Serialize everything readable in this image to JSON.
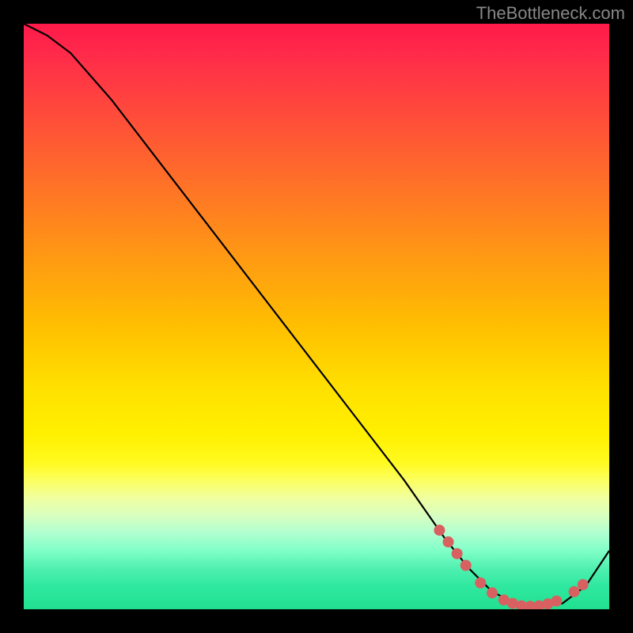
{
  "watermark": "TheBottleneck.com",
  "chart_data": {
    "type": "line",
    "title": "",
    "xlabel": "",
    "ylabel": "",
    "xlim": [
      0,
      100
    ],
    "ylim": [
      0,
      100
    ],
    "series": [
      {
        "name": "bottleneck-curve",
        "x": [
          0,
          4,
          8,
          15,
          25,
          35,
          45,
          55,
          65,
          72,
          76,
          80,
          84,
          88,
          92,
          96,
          100
        ],
        "values": [
          100,
          98,
          95,
          87,
          74,
          61,
          48,
          35,
          22,
          12,
          7,
          3,
          1,
          0.5,
          1,
          4,
          10
        ]
      }
    ],
    "markers": {
      "name": "highlight-points",
      "color": "#d86060",
      "points": [
        {
          "x": 71,
          "y": 13.5
        },
        {
          "x": 72.5,
          "y": 11.5
        },
        {
          "x": 74,
          "y": 9.5
        },
        {
          "x": 75.5,
          "y": 7.5
        },
        {
          "x": 78,
          "y": 4.5
        },
        {
          "x": 80,
          "y": 2.8
        },
        {
          "x": 82,
          "y": 1.6
        },
        {
          "x": 83.5,
          "y": 1.0
        },
        {
          "x": 85,
          "y": 0.6
        },
        {
          "x": 86.5,
          "y": 0.5
        },
        {
          "x": 88,
          "y": 0.6
        },
        {
          "x": 89.5,
          "y": 0.9
        },
        {
          "x": 91,
          "y": 1.4
        },
        {
          "x": 94,
          "y": 3.0
        },
        {
          "x": 95.5,
          "y": 4.2
        }
      ]
    }
  }
}
